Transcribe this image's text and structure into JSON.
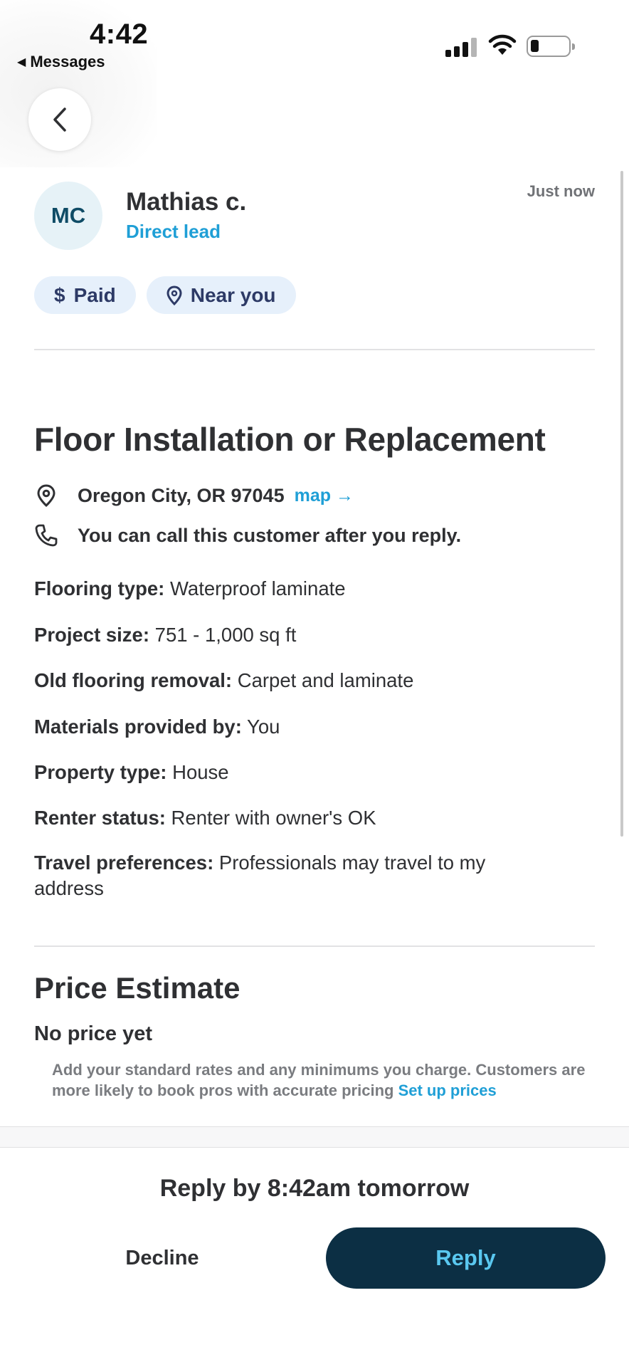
{
  "status_bar": {
    "time": "4:42",
    "back_app_label": "Messages",
    "battery_level": 0.15
  },
  "nav": {
    "back_icon": "chevron-left-icon"
  },
  "customer": {
    "initials": "MC",
    "name": "Mathias c.",
    "lead_type": "Direct lead",
    "timestamp": "Just now"
  },
  "badges": [
    {
      "icon": "dollar-icon",
      "glyph": "$",
      "label": "Paid"
    },
    {
      "icon": "location-pin-icon",
      "label": "Near you"
    }
  ],
  "job": {
    "title": "Floor Installation or Replacement",
    "location": "Oregon City, OR 97045",
    "map_link": "map →",
    "call_note": "You can call this customer after you reply."
  },
  "details": [
    {
      "key": "Flooring type:",
      "value": " Waterproof laminate"
    },
    {
      "key": "Project size:",
      "value": " 751 - 1,000 sq ft"
    },
    {
      "key": "Old flooring removal:",
      "value": " Carpet and laminate"
    },
    {
      "key": "Materials provided by:",
      "value": " You"
    },
    {
      "key": "Property type:",
      "value": " House"
    },
    {
      "key": "Renter status:",
      "value": " Renter with owner's OK"
    },
    {
      "key": "Travel preferences:",
      "value": " Professionals may travel to my address"
    }
  ],
  "price": {
    "heading": "Price Estimate",
    "status": "No price yet",
    "note": "Add your standard rates and any minimums you charge. Customers are more likely to book pros with accurate pricing ",
    "link": "Set up prices"
  },
  "footer": {
    "reply_by": "Reply by 8:42am tomorrow",
    "decline_label": "Decline",
    "reply_label": "Reply"
  },
  "colors": {
    "accent_blue": "#1f9fd6",
    "primary_dark": "#0c2f44",
    "reply_text": "#5ac8f0",
    "chip_bg": "#e6f0fb",
    "avatar_bg": "#e6f2f7"
  }
}
